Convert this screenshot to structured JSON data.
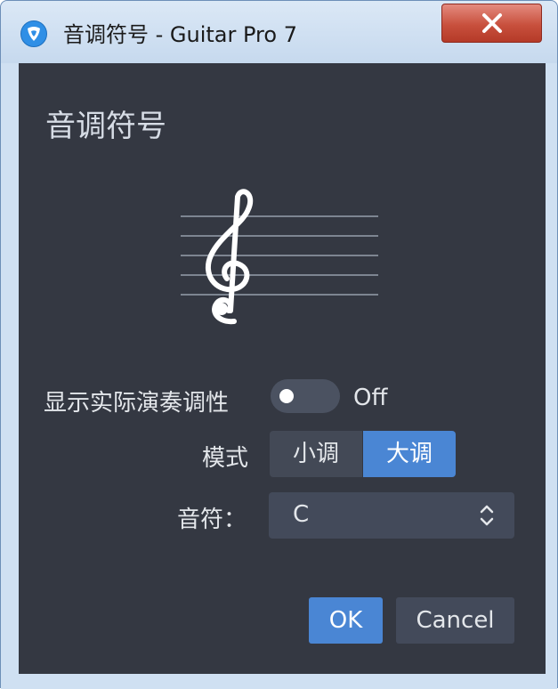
{
  "window": {
    "title": "音调符号 - Guitar Pro 7"
  },
  "dialog": {
    "heading": "音调符号",
    "show_actual_key_label": "显示实际演奏调性",
    "toggle_state_label": "Off",
    "toggle_on": false,
    "mode_label": "模式",
    "mode_options": [
      "小调",
      "大调"
    ],
    "mode_selected": "大调",
    "note_label": "音符：",
    "note_value": "C"
  },
  "buttons": {
    "ok": "OK",
    "cancel": "Cancel"
  },
  "icons": {
    "app": "guitar-pro-pick-icon",
    "close": "close-icon",
    "clef": "treble-clef-icon",
    "select_arrows": "updown-chevron-icon"
  },
  "colors": {
    "panel_bg": "#343842",
    "accent": "#4a86d4",
    "control_bg": "#434a5a"
  }
}
